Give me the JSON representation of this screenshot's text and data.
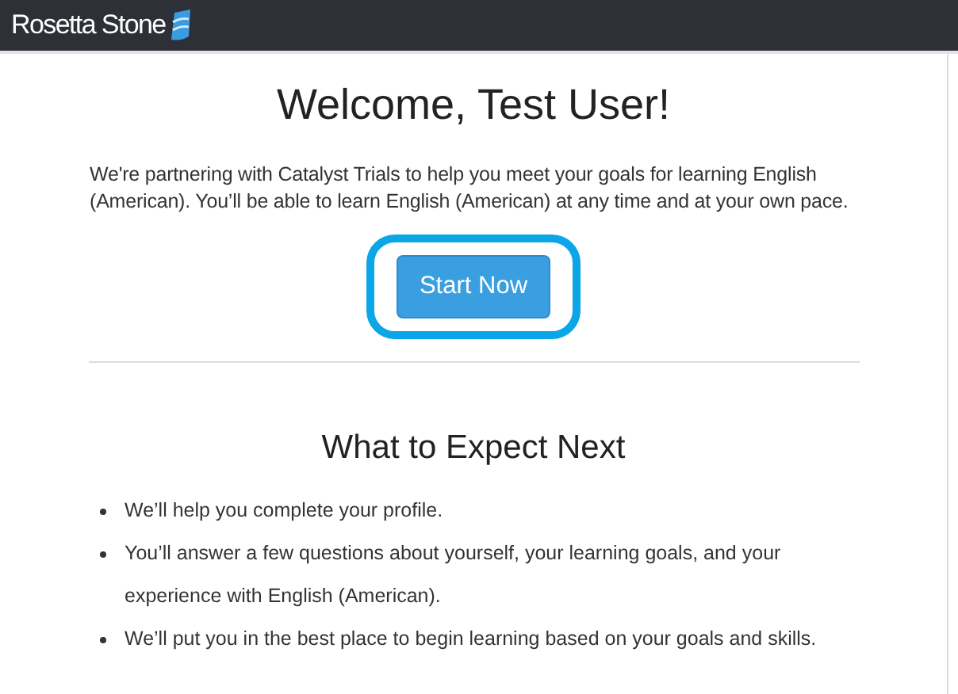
{
  "header": {
    "logo_text": "Rosetta Stone"
  },
  "title": "Welcome, Test User!",
  "intro": "We're partnering with Catalyst Trials to help you meet your goals for learning English (American). You’ll be able to learn English (American) at any time and at your own pace.",
  "start_button": {
    "label": "Start Now",
    "highlighted": true
  },
  "next_section": {
    "heading": "What to Expect Next",
    "items": [
      "We’ll help you complete your profile.",
      "You’ll answer a few questions about yourself, your learning goals, and your experience with English (American).",
      "We’ll put you in the best place to begin learning based on your goals and skills."
    ]
  }
}
